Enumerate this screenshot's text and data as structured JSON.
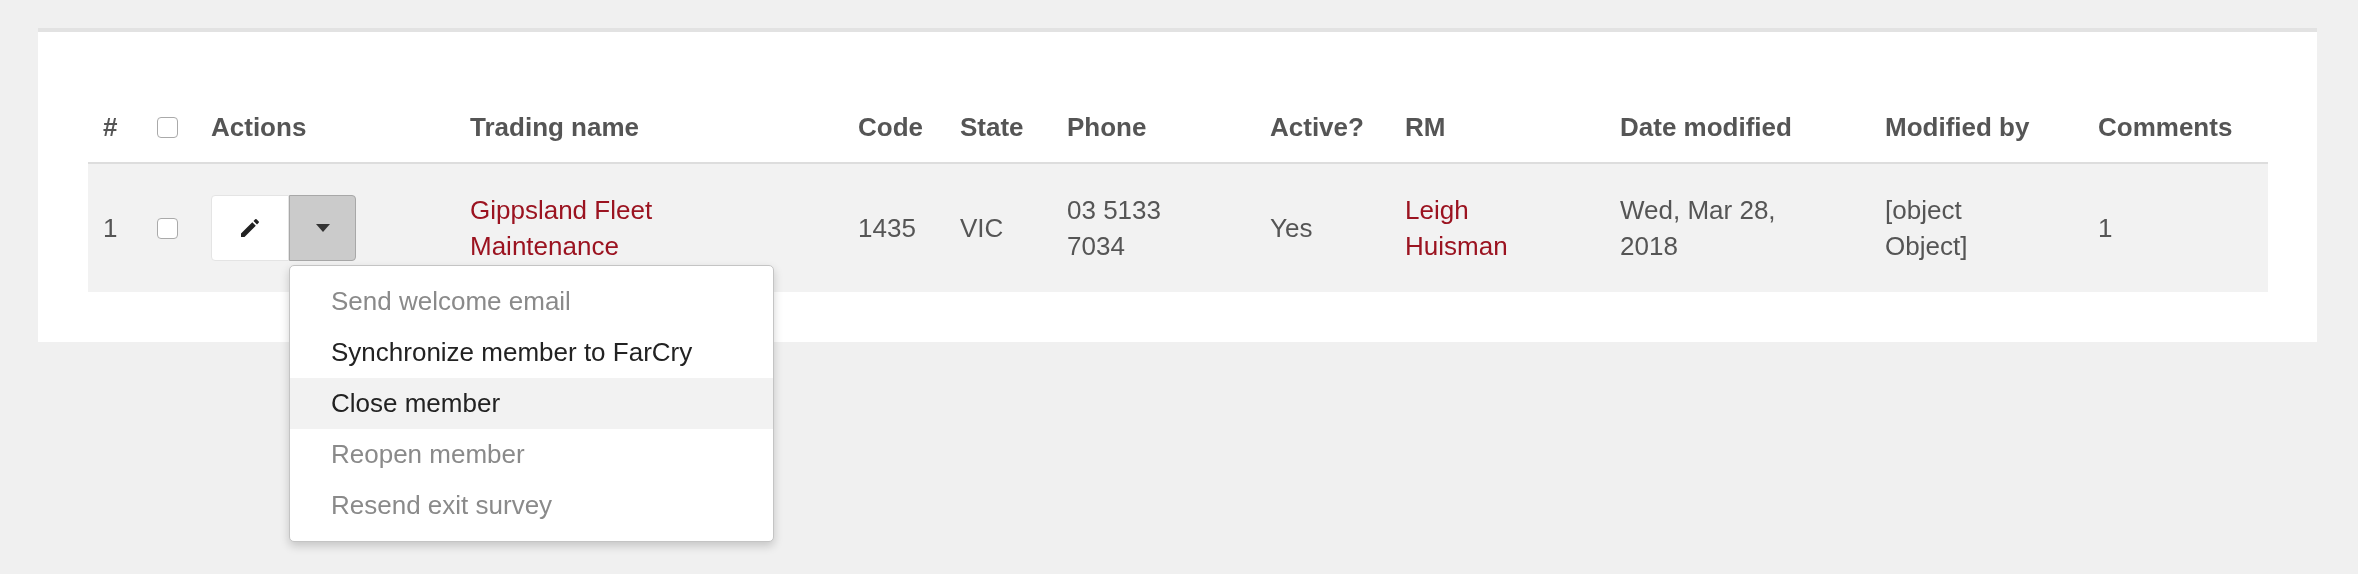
{
  "table": {
    "columns": [
      {
        "kind": "text",
        "label": "#"
      },
      {
        "kind": "checkbox",
        "checked": false
      },
      {
        "kind": "text",
        "label": "Actions"
      },
      {
        "kind": "text",
        "label": "Trading name"
      },
      {
        "kind": "text",
        "label": "Code"
      },
      {
        "kind": "text",
        "label": "State"
      },
      {
        "kind": "text",
        "label": "Phone"
      },
      {
        "kind": "text",
        "label": "Active?"
      },
      {
        "kind": "text",
        "label": "RM"
      },
      {
        "kind": "text",
        "label": "Date modified"
      },
      {
        "kind": "text",
        "label": "Modified by"
      },
      {
        "kind": "text",
        "label": "Comments"
      }
    ],
    "rows": [
      {
        "cells": [
          {
            "kind": "text",
            "value": "1"
          },
          {
            "kind": "checkbox",
            "checked": false
          },
          {
            "kind": "actions",
            "menu_open": true
          },
          {
            "kind": "link",
            "value": "Gippsland Fleet Maintenance"
          },
          {
            "kind": "text",
            "value": "1435"
          },
          {
            "kind": "text",
            "value": "VIC"
          },
          {
            "kind": "text",
            "value": "03 5133 7034"
          },
          {
            "kind": "text",
            "value": "Yes"
          },
          {
            "kind": "link",
            "value": "Leigh Huisman"
          },
          {
            "kind": "text",
            "value": "Wed, Mar 28, 2018"
          },
          {
            "kind": "text",
            "value": "[object Object]"
          },
          {
            "kind": "text",
            "value": "1"
          }
        ]
      }
    ]
  },
  "dropdown_menu": {
    "items": [
      {
        "label": "Send welcome email",
        "disabled": true,
        "selected": false
      },
      {
        "label": "Synchronize member to FarCry",
        "disabled": false,
        "selected": false
      },
      {
        "label": "Close member",
        "disabled": false,
        "selected": true
      },
      {
        "label": "Reopen member",
        "disabled": true,
        "selected": false
      },
      {
        "label": "Resend exit survey",
        "disabled": true,
        "selected": false
      }
    ]
  }
}
